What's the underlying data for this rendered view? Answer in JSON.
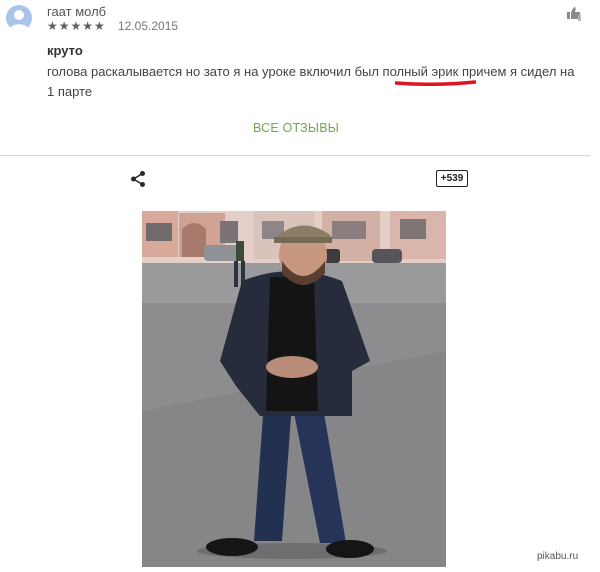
{
  "review": {
    "reviewer_name": "гаат молб",
    "stars": "★★★★★",
    "rating": 5,
    "date": "12.05.2015",
    "title": "круто",
    "body": "голова раскалывается но зато я на уроке включил был полный эрик причем я сидел на 1 парте"
  },
  "all_reviews_label": "ВСЕ ОТЗЫВЫ",
  "plus_count": "+539",
  "watermark": "pikabu.ru",
  "colors": {
    "link_green": "#7aa34a",
    "annotation_red": "#e0141e",
    "avatar_blue": "#a8c4e8"
  },
  "icons": {
    "thumb": "thumbs-up-down-icon",
    "share": "share-icon",
    "avatar": "person-icon"
  }
}
